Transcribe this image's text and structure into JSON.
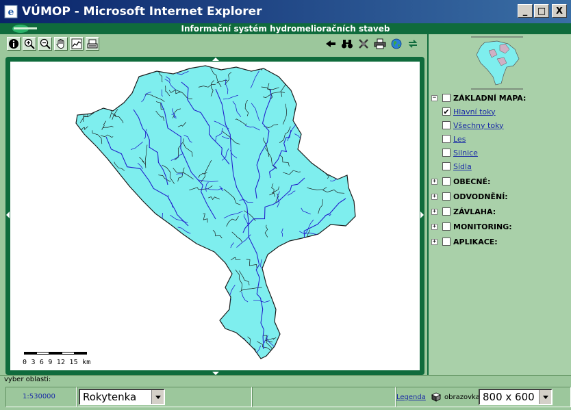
{
  "window": {
    "title": "VÚMOP - Microsoft Internet Explorer",
    "minimize_label": "_",
    "maximize_label": "□",
    "close_label": "X"
  },
  "app": {
    "title": "Informační systém hydromelioračních staveb"
  },
  "toolbar": {
    "left_tools": [
      {
        "name": "info-tool",
        "icon": "info-icon"
      },
      {
        "name": "zoom-in-tool",
        "icon": "zoom-in-icon"
      },
      {
        "name": "zoom-out-tool",
        "icon": "zoom-out-icon"
      },
      {
        "name": "pan-tool",
        "icon": "hand-icon"
      },
      {
        "name": "profile-tool",
        "icon": "profile-icon"
      },
      {
        "name": "print-map-tool",
        "icon": "device-icon"
      }
    ],
    "right_tools": [
      {
        "name": "back-tool",
        "icon": "arrow-left-icon"
      },
      {
        "name": "search-tool",
        "icon": "binoculars-icon"
      },
      {
        "name": "clear-tool",
        "icon": "cross-icon"
      },
      {
        "name": "print-tool",
        "icon": "printer-icon"
      },
      {
        "name": "globe-tool",
        "icon": "globe-icon"
      },
      {
        "name": "refresh-tool",
        "icon": "refresh-icon"
      }
    ]
  },
  "map": {
    "scale_labels": "0  3  6  9  12  15 km",
    "colors": {
      "land": "#7eeeee",
      "border": "#1a1a1a",
      "river": "#2222cc",
      "frame": "#0f6b3c"
    }
  },
  "layers": {
    "groups": [
      {
        "label": "ZÁKLADNÍ MAPA:",
        "expander": "−",
        "checked": false,
        "items": [
          {
            "label": "Hlavní toky",
            "checked": true
          },
          {
            "label": "Všechny toky",
            "checked": false
          },
          {
            "label": "Les",
            "checked": false
          },
          {
            "label": "Silnice",
            "checked": false
          },
          {
            "label": "Sídla",
            "checked": false
          }
        ]
      },
      {
        "label": "OBECNÉ:",
        "expander": "+",
        "checked": false,
        "items": []
      },
      {
        "label": "ODVODNĚNÍ:",
        "expander": "+",
        "checked": false,
        "items": []
      },
      {
        "label": "ZÁVLAHA:",
        "expander": "+",
        "checked": false,
        "items": []
      },
      {
        "label": "MONITORING:",
        "expander": "+",
        "checked": false,
        "items": []
      },
      {
        "label": "APLIKACE:",
        "expander": "+",
        "checked": false,
        "items": []
      }
    ]
  },
  "status": {
    "area_prompt": "vyber oblasti:"
  },
  "bottom": {
    "scale": "1:530000",
    "area_selected": "Rokytenka",
    "legend_link": "Legenda",
    "screen_label": "obrazovka:",
    "screen_selected": "800 x 600"
  }
}
